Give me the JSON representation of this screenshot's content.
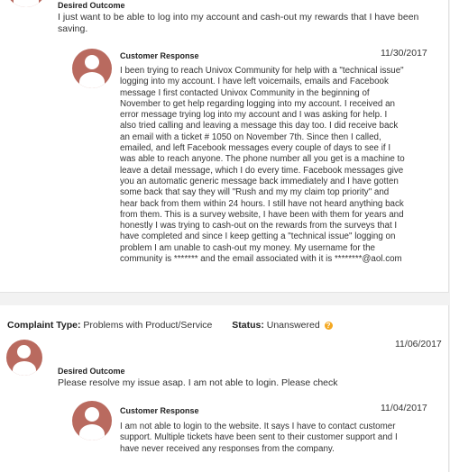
{
  "complaint_1": {
    "desired_outcome_label": "Desired Outcome",
    "desired_outcome_lines": [
      "I just want to be able to log into my account and cash-out my rewards that I have been",
      "saving."
    ],
    "response": {
      "label": "Customer Response",
      "date": "11/30/2017",
      "lines": [
        "I been trying to reach Univox Community for help with a \"technical issue\"",
        "logging into my account. I have left voicemails, emails and Facebook",
        "message I first contacted Univox Community in the beginning of",
        "November to get help regarding logging into my account. I received an",
        "error message trying log into my account and I was asking for help. I",
        "also tried calling and leaving a message this day too. I did receive back",
        "an email with a ticket # 1050 on November 7th. Since then I called,",
        "emailed, and left Facebook messages every couple of days to see if I",
        "was able to reach anyone. The phone number all you get is a machine to",
        "leave a detail message, which I do every time. Facebook messages give",
        "you an automatic generic message back immediately and I have gotten",
        "some back that say they will \"Rush and my my claim top priority\" and",
        "hear back from them within 24 hours. I still have not heard anything back",
        "from them. This is a survey website, I have been with them for years and",
        "honestly I was trying to cash-out on the rewards from the surveys that I",
        "have completed and since I keep getting a \"technical issue\" logging on",
        "problem I am unable to cash-out my money. My username for the",
        "community is ******* and the email associated with it is ********@aol.com"
      ]
    }
  },
  "complaint_2": {
    "type_label": "Complaint Type:",
    "type_value": "Problems with Product/Service",
    "status_label": "Status:",
    "status_value": "Unanswered",
    "help_glyph": "?",
    "date": "11/06/2017",
    "desired_outcome_label": "Desired Outcome",
    "desired_outcome_text": "Please resolve my issue asap. I am not able to login. Please check",
    "response": {
      "label": "Customer Response",
      "date": "11/04/2017",
      "lines": [
        "I am not able to login to the website. It says I have to contact customer",
        "support. Multiple tickets have been sent to their customer support and I",
        "have never received any responses from the company."
      ]
    }
  },
  "colors": {
    "avatar": "#b96a5f",
    "status_help": "#f4a821",
    "page_bg": "#f2f2f2"
  },
  "icons": {
    "avatar": "user-avatar-icon",
    "help": "question-circle-icon"
  }
}
